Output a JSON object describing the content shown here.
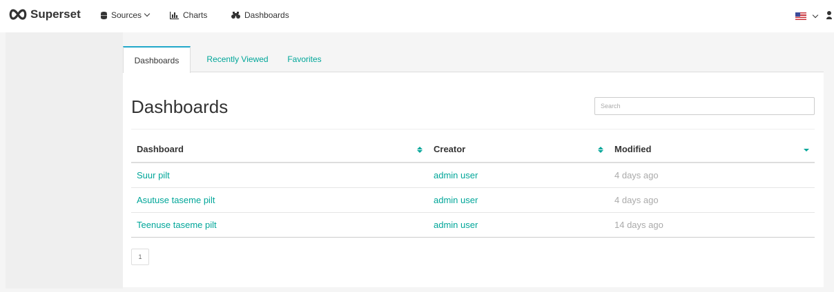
{
  "brand": {
    "name": "Superset"
  },
  "nav": {
    "sources_label": "Sources",
    "charts_label": "Charts",
    "dashboards_label": "Dashboards"
  },
  "tabs": [
    {
      "label": "Dashboards",
      "active": true
    },
    {
      "label": "Recently Viewed",
      "active": false
    },
    {
      "label": "Favorites",
      "active": false
    }
  ],
  "main": {
    "title": "Dashboards",
    "search_placeholder": "Search"
  },
  "table": {
    "headers": [
      "Dashboard",
      "Creator",
      "Modified"
    ],
    "rows": [
      {
        "dashboard": "Suur pilt",
        "creator": "admin user",
        "modified": "4 days ago"
      },
      {
        "dashboard": "Asutuse taseme pilt",
        "creator": "admin user",
        "modified": "4 days ago"
      },
      {
        "dashboard": "Teenuse taseme pilt",
        "creator": "admin user",
        "modified": "14 days ago"
      }
    ]
  },
  "pagination": {
    "current_page": "1"
  },
  "colors": {
    "accent": "#00a699",
    "tab_border": "#20a7c9",
    "background": "#f5f5f5"
  },
  "icons": [
    "superset-logo-icon",
    "database-icon",
    "bar-chart-icon",
    "dashboard-icon",
    "flag-us-icon",
    "user-icon",
    "sort-icon",
    "sort-desc-icon"
  ]
}
